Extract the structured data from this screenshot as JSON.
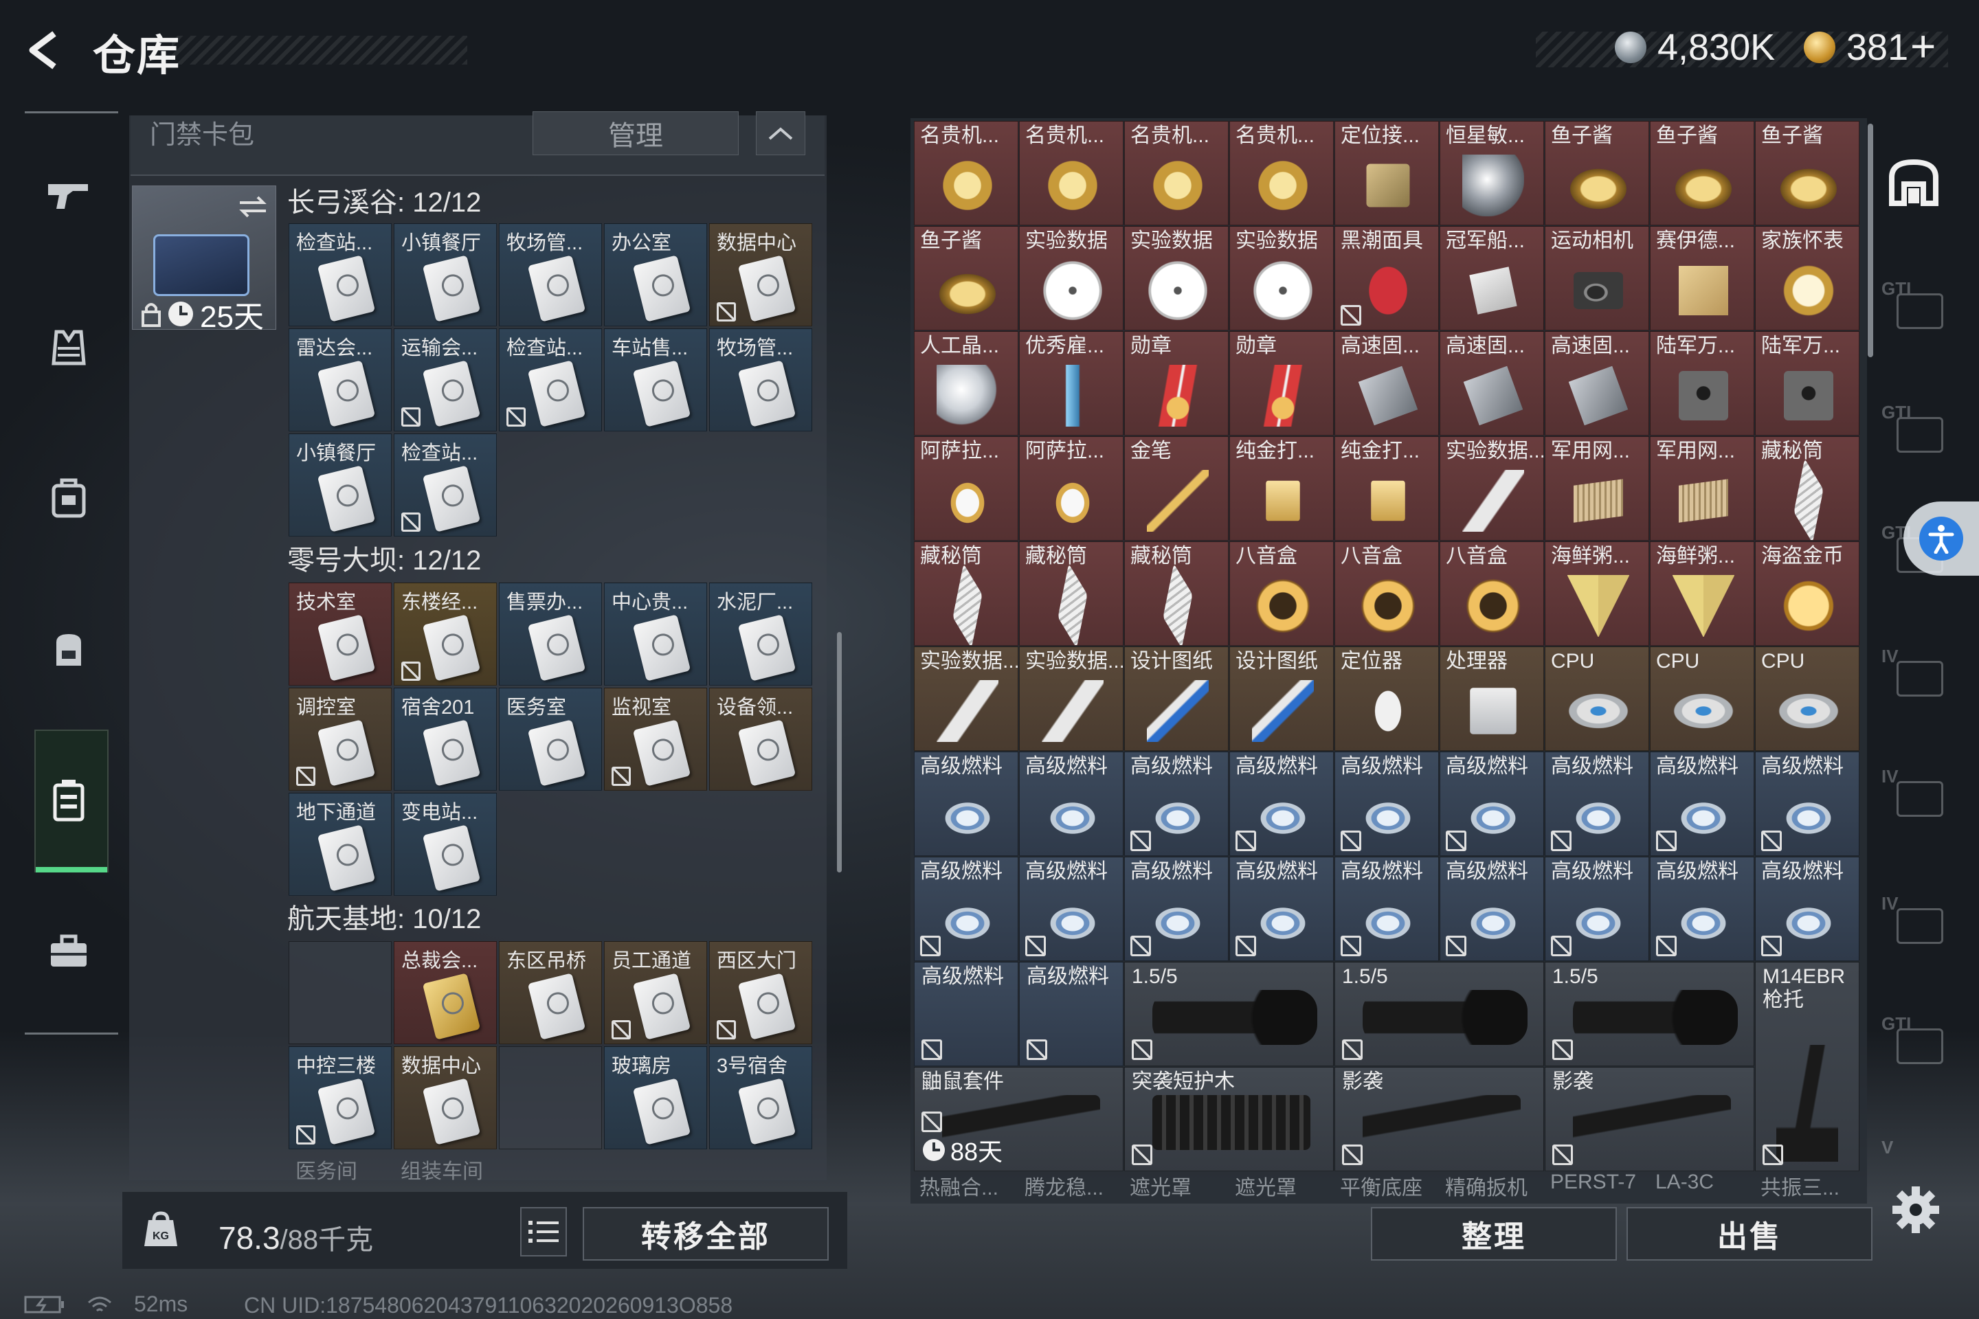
{
  "header": {
    "title": "仓库"
  },
  "currency": {
    "silver": "4,830K",
    "gold": "381",
    "plus": "+"
  },
  "left_sidebar": {
    "items": [
      {
        "name": "weapon"
      },
      {
        "name": "armor"
      },
      {
        "name": "backpack"
      },
      {
        "name": "bag"
      },
      {
        "name": "key-card",
        "active": true
      },
      {
        "name": "briefcase"
      }
    ]
  },
  "key_panel": {
    "header_label": "门禁卡包",
    "manage_label": "管理",
    "bag_timer": "25天",
    "zones": [
      {
        "name": "长弓溪谷: 12/12",
        "cards": [
          {
            "label": "检查站...",
            "color": "b-blue",
            "nb": false
          },
          {
            "label": "小镇餐厅",
            "color": "b-blue",
            "nb": false
          },
          {
            "label": "牧场管...",
            "color": "b-blue",
            "nb": false
          },
          {
            "label": "办公室",
            "color": "b-blue",
            "nb": false
          },
          {
            "label": "数据中心",
            "color": "b-brown",
            "nb": true
          },
          {
            "label": "雷达会...",
            "color": "b-blue",
            "nb": false
          },
          {
            "label": "运输会...",
            "color": "b-blue",
            "nb": true
          },
          {
            "label": "检查站...",
            "color": "b-blue",
            "nb": true
          },
          {
            "label": "车站售...",
            "color": "b-blue",
            "nb": false
          },
          {
            "label": "牧场管...",
            "color": "b-blue",
            "nb": false
          },
          {
            "label": "小镇餐厅",
            "color": "b-blue",
            "nb": false
          },
          {
            "label": "检查站...",
            "color": "b-blue",
            "nb": true
          }
        ]
      },
      {
        "name": "零号大坝: 12/12",
        "cards": [
          {
            "label": "技术室",
            "color": "b-red",
            "nb": false
          },
          {
            "label": "东楼经...",
            "color": "b-gold",
            "nb": true
          },
          {
            "label": "售票办...",
            "color": "b-blue",
            "nb": false
          },
          {
            "label": "中心贵...",
            "color": "b-blue",
            "nb": false
          },
          {
            "label": "水泥厂...",
            "color": "b-blue",
            "nb": false
          },
          {
            "label": "调控室",
            "color": "b-brown",
            "nb": true
          },
          {
            "label": "宿舍201",
            "color": "b-blue",
            "nb": false
          },
          {
            "label": "医务室",
            "color": "b-blue",
            "nb": false
          },
          {
            "label": "监视室",
            "color": "b-brown",
            "nb": true
          },
          {
            "label": "设备领...",
            "color": "b-brown",
            "nb": false
          },
          {
            "label": "地下通道",
            "color": "b-blue",
            "nb": false
          },
          {
            "label": "变电站...",
            "color": "b-blue",
            "nb": false
          }
        ]
      },
      {
        "name": "航天基地: 10/12",
        "cards": [
          {
            "label": "",
            "color": "b-empty",
            "nb": false,
            "empty": true
          },
          {
            "label": "总裁会...",
            "color": "b-red",
            "nb": false,
            "gold": true
          },
          {
            "label": "东区吊桥",
            "color": "b-brown",
            "nb": false
          },
          {
            "label": "员工通道",
            "color": "b-brown",
            "nb": true
          },
          {
            "label": "西区大门",
            "color": "b-brown",
            "nb": true
          },
          {
            "label": "中控三楼",
            "color": "b-blue",
            "nb": true
          },
          {
            "label": "数据中心",
            "color": "b-brown",
            "nb": false
          },
          {
            "label": "",
            "color": "b-empty",
            "nb": false,
            "empty": true
          },
          {
            "label": "玻璃房",
            "color": "b-blue",
            "nb": false
          },
          {
            "label": "3号宿舍",
            "color": "b-blue",
            "nb": false
          }
        ]
      }
    ],
    "partial_labels": [
      "医务间",
      "组装车间"
    ]
  },
  "left_bottom": {
    "weight": "78.3",
    "capacity": "/88千克",
    "transfer_label": "转移全部"
  },
  "inventory": {
    "rows": [
      [
        {
          "label": "名贵机...",
          "color": "r-red",
          "icon": "watch"
        },
        {
          "label": "名贵机...",
          "color": "r-red",
          "icon": "watch"
        },
        {
          "label": "名贵机...",
          "color": "r-red",
          "icon": "watch"
        },
        {
          "label": "名贵机...",
          "color": "r-red",
          "icon": "watch"
        },
        {
          "label": "定位接...",
          "color": "r-red",
          "icon": "device"
        },
        {
          "label": "恒星敏...",
          "color": "r-red",
          "icon": "lens"
        },
        {
          "label": "鱼子酱",
          "color": "r-red",
          "icon": "tin"
        },
        {
          "label": "鱼子酱",
          "color": "r-red",
          "icon": "tin"
        },
        {
          "label": "鱼子酱",
          "color": "r-red",
          "icon": "tin"
        }
      ],
      [
        {
          "label": "鱼子酱",
          "color": "r-red",
          "icon": "tin"
        },
        {
          "label": "实验数据",
          "color": "r-red",
          "icon": "disc"
        },
        {
          "label": "实验数据",
          "color": "r-red",
          "icon": "disc"
        },
        {
          "label": "实验数据",
          "color": "r-red",
          "icon": "disc"
        },
        {
          "label": "黑潮面具",
          "color": "r-red",
          "icon": "mask",
          "nb": true
        },
        {
          "label": "冠军船...",
          "color": "r-red",
          "icon": "paper"
        },
        {
          "label": "运动相机",
          "color": "r-red",
          "icon": "camera"
        },
        {
          "label": "赛伊德...",
          "color": "r-red",
          "icon": "scroll"
        },
        {
          "label": "家族怀表",
          "color": "r-red",
          "icon": "pocketwatch"
        }
      ],
      [
        {
          "label": "人工晶...",
          "color": "r-red",
          "icon": "gem"
        },
        {
          "label": "优秀雇...",
          "color": "r-red",
          "icon": "crystal"
        },
        {
          "label": "勋章",
          "color": "r-red",
          "icon": "medal"
        },
        {
          "label": "勋章",
          "color": "r-red",
          "icon": "medal"
        },
        {
          "label": "高速固...",
          "color": "r-red",
          "icon": "drive"
        },
        {
          "label": "高速固...",
          "color": "r-red",
          "icon": "drive"
        },
        {
          "label": "高速固...",
          "color": "r-red",
          "icon": "drive"
        },
        {
          "label": "陆军万...",
          "color": "r-red",
          "icon": "radio"
        },
        {
          "label": "陆军万...",
          "color": "r-red",
          "icon": "radio"
        }
      ],
      [
        {
          "label": "阿萨拉...",
          "color": "r-red",
          "icon": "cup"
        },
        {
          "label": "阿萨拉...",
          "color": "r-red",
          "icon": "cup"
        },
        {
          "label": "金笔",
          "color": "r-red",
          "icon": "pen"
        },
        {
          "label": "纯金打...",
          "color": "r-red",
          "icon": "lighter"
        },
        {
          "label": "纯金打...",
          "color": "r-red",
          "icon": "lighter"
        },
        {
          "label": "实验数据...",
          "color": "r-red",
          "icon": "usb"
        },
        {
          "label": "军用网...",
          "color": "r-red",
          "icon": "router"
        },
        {
          "label": "军用网...",
          "color": "r-red",
          "icon": "router"
        },
        {
          "label": "藏秘筒",
          "color": "r-red",
          "icon": "cylinder"
        }
      ],
      [
        {
          "label": "藏秘筒",
          "color": "r-red",
          "icon": "cylinder"
        },
        {
          "label": "藏秘筒",
          "color": "r-red",
          "icon": "cylinder"
        },
        {
          "label": "藏秘筒",
          "color": "r-red",
          "icon": "cylinder"
        },
        {
          "label": "八音盒",
          "color": "r-red",
          "icon": "musicbox"
        },
        {
          "label": "八音盒",
          "color": "r-red",
          "icon": "musicbox"
        },
        {
          "label": "八音盒",
          "color": "r-red",
          "icon": "musicbox"
        },
        {
          "label": "海鲜粥...",
          "color": "r-red",
          "icon": "pyramid"
        },
        {
          "label": "海鲜粥...",
          "color": "r-red",
          "icon": "pyramid"
        },
        {
          "label": "海盗金币",
          "color": "r-red",
          "icon": "coin"
        }
      ],
      [
        {
          "label": "实验数据...",
          "color": "r-brown",
          "icon": "usb"
        },
        {
          "label": "实验数据...",
          "color": "r-brown",
          "icon": "usb"
        },
        {
          "label": "设计图纸",
          "color": "r-brown",
          "icon": "blueprint"
        },
        {
          "label": "设计图纸",
          "color": "r-brown",
          "icon": "blueprint"
        },
        {
          "label": "定位器",
          "color": "r-brown",
          "icon": "tracker"
        },
        {
          "label": "处理器",
          "color": "r-brown",
          "icon": "processor"
        },
        {
          "label": "CPU",
          "color": "r-brown",
          "icon": "cpu"
        },
        {
          "label": "CPU",
          "color": "r-brown",
          "icon": "cpu"
        },
        {
          "label": "CPU",
          "color": "r-brown",
          "icon": "cpu"
        }
      ],
      [
        {
          "label": "高级燃料",
          "color": "r-blue",
          "icon": "fuel"
        },
        {
          "label": "高级燃料",
          "color": "r-blue",
          "icon": "fuel"
        },
        {
          "label": "高级燃料",
          "color": "r-blue",
          "icon": "fuel",
          "nb": true
        },
        {
          "label": "高级燃料",
          "color": "r-blue",
          "icon": "fuel",
          "nb": true
        },
        {
          "label": "高级燃料",
          "color": "r-blue",
          "icon": "fuel",
          "nb": true
        },
        {
          "label": "高级燃料",
          "color": "r-blue",
          "icon": "fuel",
          "nb": true
        },
        {
          "label": "高级燃料",
          "color": "r-blue",
          "icon": "fuel",
          "nb": true
        },
        {
          "label": "高级燃料",
          "color": "r-blue",
          "icon": "fuel",
          "nb": true
        },
        {
          "label": "高级燃料",
          "color": "r-blue",
          "icon": "fuel",
          "nb": true
        }
      ],
      [
        {
          "label": "高级燃料",
          "color": "r-blue",
          "icon": "fuel",
          "nb": true
        },
        {
          "label": "高级燃料",
          "color": "r-blue",
          "icon": "fuel",
          "nb": true
        },
        {
          "label": "高级燃料",
          "color": "r-blue",
          "icon": "fuel",
          "nb": true
        },
        {
          "label": "高级燃料",
          "color": "r-blue",
          "icon": "fuel",
          "nb": true
        },
        {
          "label": "高级燃料",
          "color": "r-blue",
          "icon": "fuel",
          "nb": true
        },
        {
          "label": "高级燃料",
          "color": "r-blue",
          "icon": "fuel",
          "nb": true
        },
        {
          "label": "高级燃料",
          "color": "r-blue",
          "icon": "fuel",
          "nb": true
        },
        {
          "label": "高级燃料",
          "color": "r-blue",
          "icon": "fuel",
          "nb": true
        },
        {
          "label": "高级燃料",
          "color": "r-blue",
          "icon": "fuel",
          "nb": true
        }
      ]
    ],
    "row9": [
      {
        "label": "高级燃料",
        "nb": true
      },
      {
        "label": "高级燃料",
        "nb": true
      },
      {
        "label": "1.5/5",
        "nb": true
      },
      {
        "label": "1.5/5",
        "nb": true
      },
      {
        "label": "1.5/5",
        "nb": true
      },
      {
        "label": "M14EBR\n枪托",
        "nb": true
      }
    ],
    "row10": [
      {
        "label": "鼬鼠套件",
        "timer": "88天"
      },
      {
        "label": "突袭短护木",
        "nb": true
      },
      {
        "label": "影袭",
        "nb": true
      },
      {
        "label": "影袭",
        "nb": true
      }
    ],
    "bottom_labels": [
      "热融合...",
      "腾龙稳...",
      "遮光罩",
      "遮光罩",
      "平衡底座",
      "精确扳机",
      "PERST-7",
      "LA-3C",
      "共振三..."
    ]
  },
  "right_bottom": {
    "sort_label": "整理",
    "sell_label": "出售"
  },
  "right_sidebar": {
    "tab_labels": [
      "GTI",
      "GTI",
      "GTI",
      "IV",
      "IV",
      "IV",
      "GTI",
      "V"
    ]
  },
  "status": {
    "ping": "52ms",
    "uid": "CN UID:18754806204379110632020260913O858"
  }
}
